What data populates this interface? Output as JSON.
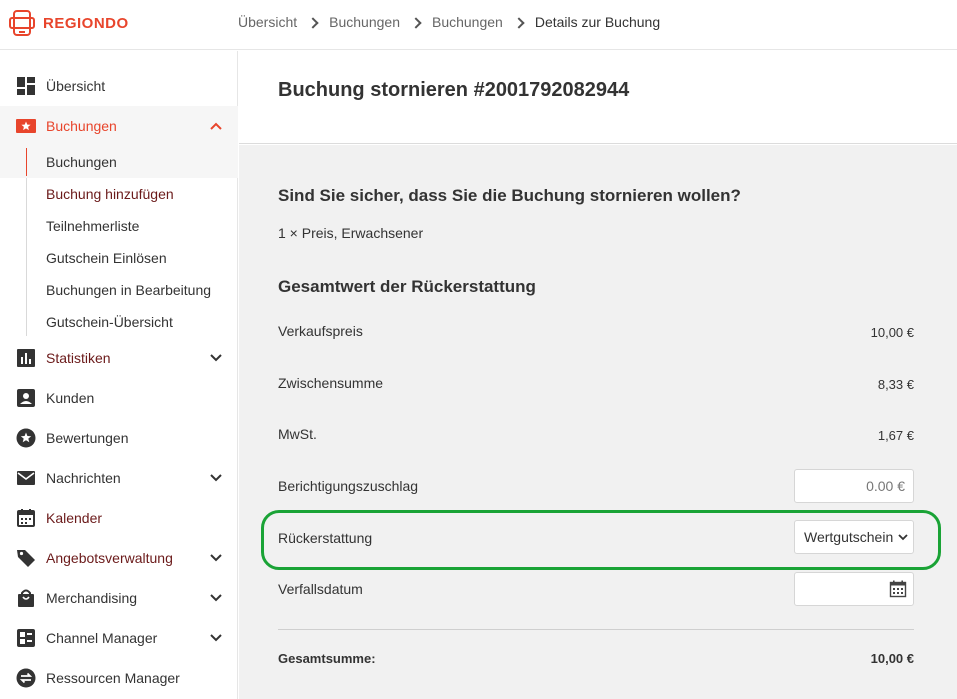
{
  "brand": {
    "name": "REGIONDO",
    "color": "#e8452c"
  },
  "breadcrumb": [
    "Übersicht",
    "Buchungen",
    "Buchungen",
    "Details zur Buchung"
  ],
  "sidebar": {
    "items": [
      {
        "label": "Übersicht",
        "icon": "dashboard-icon"
      },
      {
        "label": "Buchungen",
        "icon": "ticket-star-icon",
        "expanded": true
      },
      {
        "label": "Statistiken",
        "icon": "bar-chart-icon"
      },
      {
        "label": "Kunden",
        "icon": "person-icon"
      },
      {
        "label": "Bewertungen",
        "icon": "star-circle-icon"
      },
      {
        "label": "Nachrichten",
        "icon": "mail-icon"
      },
      {
        "label": "Kalender",
        "icon": "calendar-icon"
      },
      {
        "label": "Angebotsverwaltung",
        "icon": "tag-icon"
      },
      {
        "label": "Merchandising",
        "icon": "shopping-bag-icon"
      },
      {
        "label": "Channel Manager",
        "icon": "channel-icon"
      },
      {
        "label": "Ressourcen Manager",
        "icon": "swap-icon"
      }
    ],
    "subitems": [
      {
        "label": "Buchungen"
      },
      {
        "label": "Buchung hinzufügen"
      },
      {
        "label": "Teilnehmerliste"
      },
      {
        "label": "Gutschein Einlösen"
      },
      {
        "label": "Buchungen in Bearbeitung"
      },
      {
        "label": "Gutschein-Übersicht"
      }
    ]
  },
  "page": {
    "title": "Buchung stornieren #2001792082944",
    "question": "Sind Sie sicher, dass Sie die Buchung stornieren wollen?",
    "item_line": "1 × Preis, Erwachsener",
    "section_title": "Gesamtwert der Rückerstattung",
    "rows": {
      "verkaufspreis": {
        "label": "Verkaufspreis",
        "value": "10,00 €"
      },
      "zwischensumme": {
        "label": "Zwischensumme",
        "value": "8,33 €"
      },
      "mwst": {
        "label": "MwSt.",
        "value": "1,67 €"
      },
      "berichtigung": {
        "label": "Berichtigungszuschlag",
        "value": "0.00 €"
      },
      "rueckerstattung": {
        "label": "Rückerstattung",
        "value": "Wertgutschein"
      },
      "verfallsdatum": {
        "label": "Verfallsdatum",
        "value": ""
      }
    },
    "total": {
      "label": "Gesamtsumme:",
      "value": "10,00 €"
    }
  },
  "colors": {
    "accent": "#e8452c",
    "highlight": "#1aa336",
    "content_bg": "#f1f1f1",
    "dark_red_text": "#6b1a1a"
  }
}
